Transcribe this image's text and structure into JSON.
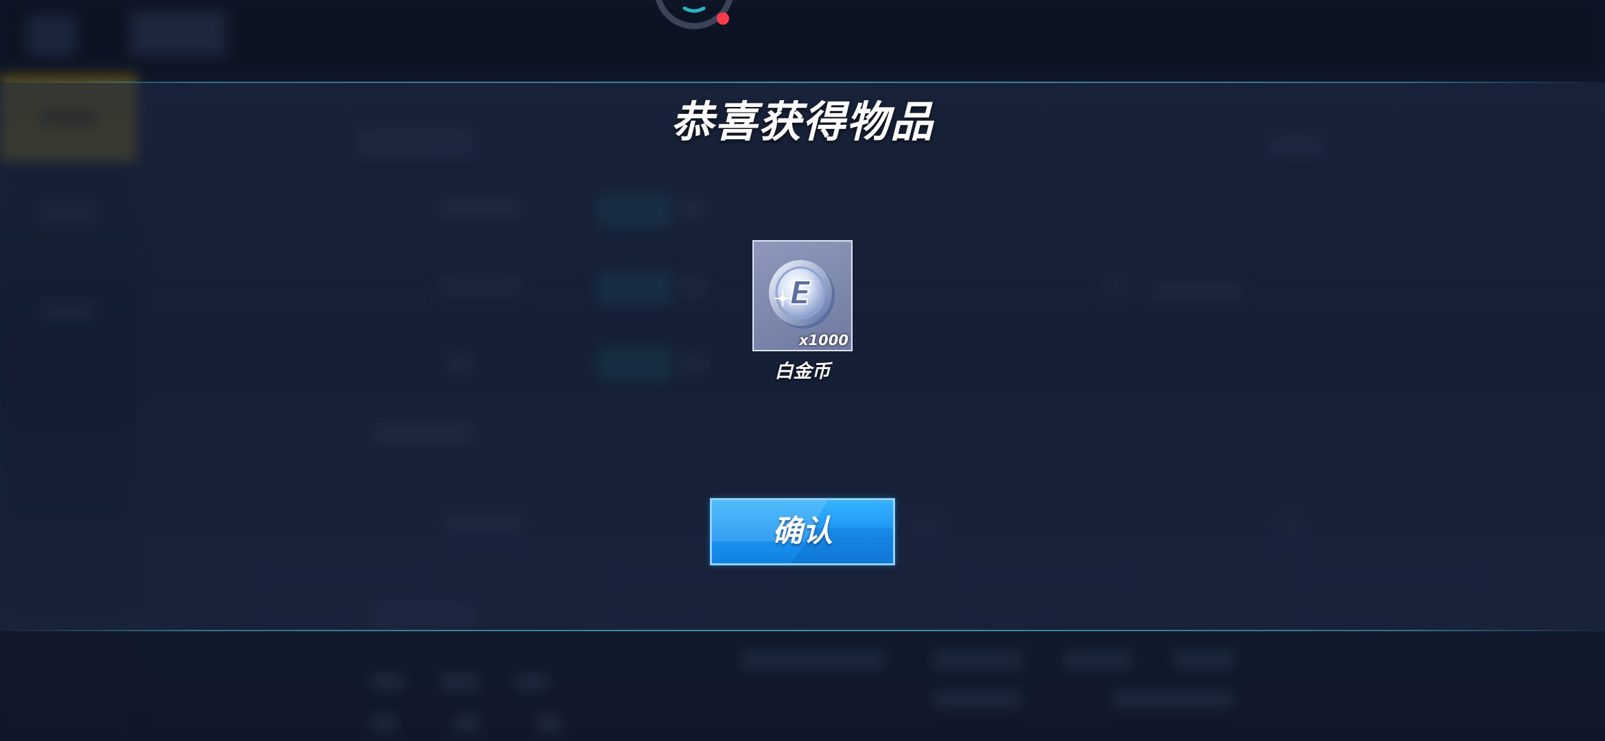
{
  "dialog": {
    "title": "恭喜获得物品",
    "reward": {
      "name": "白金币",
      "quantity": "x1000",
      "icon": "platinum-coin-icon",
      "coin_letter": "E"
    },
    "confirm_label": "确认"
  },
  "colors": {
    "button_blue": "#1a94f2",
    "accent_line": "#46b4c8",
    "sidebar_active": "#8f7519",
    "indicator_dot": "#ff3b4a",
    "indicator_arc": "#22b8c8"
  }
}
